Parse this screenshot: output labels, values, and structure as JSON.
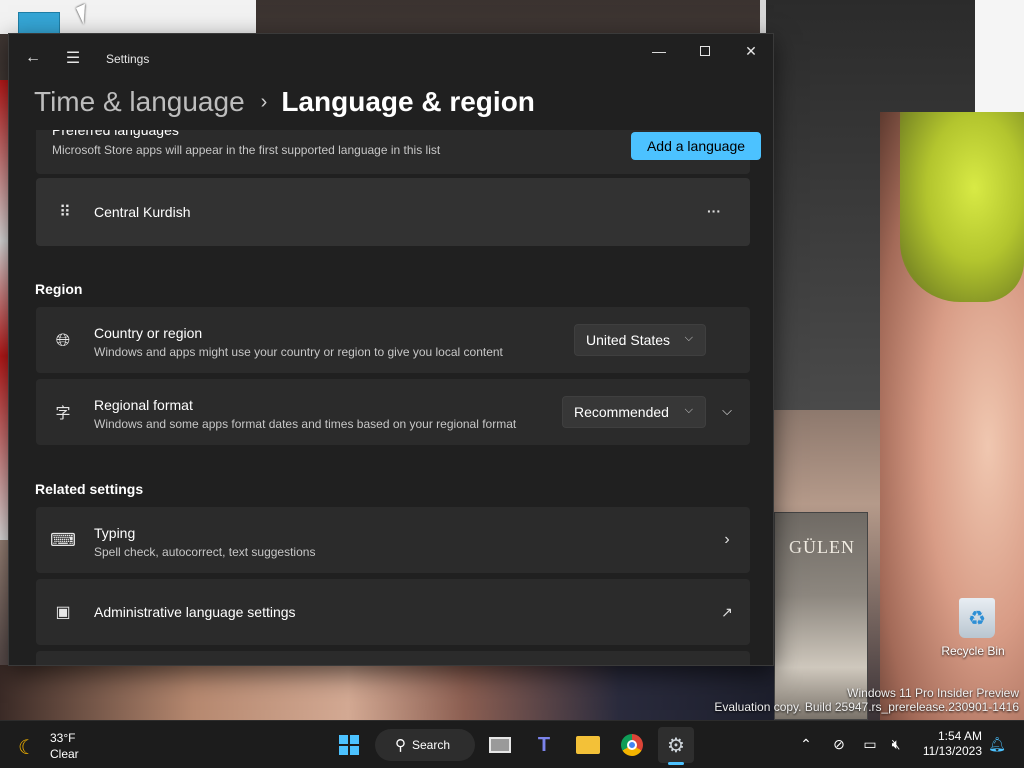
{
  "desktop": {
    "recycle_bin_label": "Recycle Bin",
    "book_title": "GÜLEN",
    "watermark_line1": "Windows 11 Pro Insider Preview",
    "watermark_line2": "Evaluation copy. Build 25947.rs_prerelease.230901-1416"
  },
  "window": {
    "app_title": "Settings",
    "icons": {
      "back": "back-arrow-icon",
      "menu": "hamburger-menu-icon",
      "minimize": "minimize-icon",
      "maximize": "maximize-icon",
      "close": "close-icon"
    },
    "breadcrumb": {
      "parent": "Time & language",
      "separator": "›",
      "current": "Language & region"
    }
  },
  "preferred_languages": {
    "title": "Preferred languages",
    "subtitle": "Microsoft Store apps will appear in the first supported language in this list",
    "add_button": "Add a language",
    "languages": [
      {
        "name": "Central Kurdish",
        "more_label": "···"
      }
    ]
  },
  "region": {
    "heading": "Region",
    "country": {
      "title": "Country or region",
      "subtitle": "Windows and apps might use your country or region to give you local content",
      "value": "United States"
    },
    "format": {
      "title": "Regional format",
      "subtitle": "Windows and some apps format dates and times based on your regional format",
      "value": "Recommended"
    }
  },
  "related": {
    "heading": "Related settings",
    "typing": {
      "title": "Typing",
      "subtitle": "Spell check, autocorrect, text suggestions"
    },
    "admin": {
      "title": "Administrative language settings"
    }
  },
  "taskbar": {
    "weather": {
      "temp": "33°F",
      "condition": "Clear"
    },
    "search_label": "Search",
    "clock": {
      "time": "1:54 AM",
      "date": "11/13/2023"
    },
    "accent_color": "#4cc2ff"
  }
}
